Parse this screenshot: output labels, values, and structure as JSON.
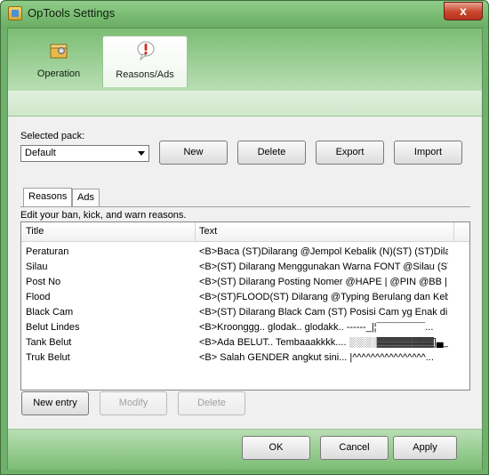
{
  "window": {
    "title": "OpTools Settings",
    "close_glyph": "x"
  },
  "top_tabs": [
    {
      "label": "Operation",
      "icon": "gear-package-icon",
      "active": false
    },
    {
      "label": "Reasons/Ads",
      "icon": "exclamation-bubble-icon",
      "active": true
    }
  ],
  "pack": {
    "label": "Selected pack:",
    "selected": "Default",
    "buttons": {
      "new": "New",
      "delete": "Delete",
      "export": "Export",
      "import": "Import"
    }
  },
  "inner_tabs": [
    {
      "label": "Reasons",
      "active": true
    },
    {
      "label": "Ads",
      "active": false
    }
  ],
  "hint": "Edit your ban, kick, and warn reasons.",
  "table": {
    "columns": [
      "Title",
      "Text"
    ],
    "rows": [
      {
        "title": "Peraturan",
        "text": "<B>Baca (ST)Dilarang @Jempol Kebalik (N)(ST) (ST)Dilar..."
      },
      {
        "title": "Silau",
        "text": "<B>(ST) Dilarang Menggunakan Warna FONT @Silau (ST..."
      },
      {
        "title": "Post No",
        "text": "<B>(ST) Dilarang Posting Nomer @HAPE | @PIN @BB | ..."
      },
      {
        "title": "Flood",
        "text": "<B>(ST)FLOOD(ST) Dilarang @Typing Berulang dan Keba..."
      },
      {
        "title": "Black Cam",
        "text": "<B>(ST) Dilarang Black Cam (ST) Posisi Cam yg Enak di Li..."
      },
      {
        "title": "Belut Lindes",
        "text": "<B>Kroonggg.. glodak.. glodakk.. ------_|¦¯¯¯¯¯¯¯¯¯..."
      },
      {
        "title": "Tank Belut",
        "text": "<B>Ada BELUT.. Tembaaakkkk.... ░░░░▓▓▓▓▓▓▓▓]▄_..."
      },
      {
        "title": "Truk Belut",
        "text": "<B> Salah GENDER angkut sini... |^^^^^^^^^^^^^^^^..."
      }
    ]
  },
  "entry_buttons": {
    "new_entry": "New entry",
    "modify": "Modify",
    "delete": "Delete"
  },
  "dialog_buttons": {
    "ok": "OK",
    "cancel": "Cancel",
    "apply": "Apply"
  },
  "colors": {
    "theme_green": "#6fb06a",
    "tab_green_light": "#b9dfb4",
    "close_red": "#c9452c"
  }
}
